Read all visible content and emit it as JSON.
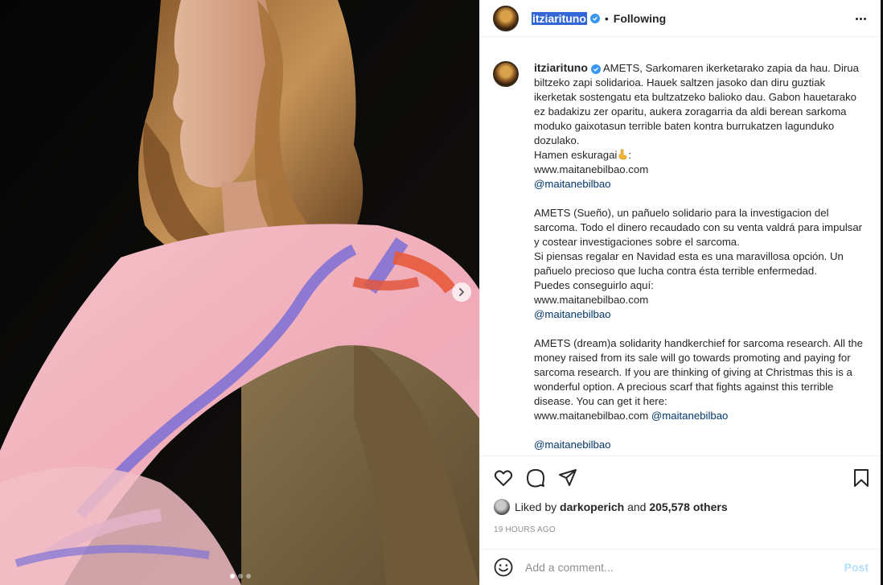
{
  "post": {
    "username": "itziarituno",
    "verified_icon": "verified-badge-icon",
    "follow_separator": "•",
    "follow_status": "Following",
    "more_icon": "more-options-icon"
  },
  "caption": {
    "username": "itziarituno",
    "paragraphs": [
      "AMETS, Sarkomaren ikerketarako zapia da hau. Dirua biltzeko zapi solidarioa. Hauek saltzen jasoko dan diru guztiak ikerketak sostengatu eta bultzatzeko balioko dau. Gabon hauetarako ez badakizu zer oparitu, aukera zoragarria da aldi berean sarkoma moduko gaixotasun terrible baten kontra burrukatzen lagunduko dozulako.",
      "Hamen eskuragai",
      ":",
      "www.maitanebilbao.com",
      "@maitanebilbao",
      "AMETS (Sueño), un pañuelo solidario para la investigacion del sarcoma. Todo el dinero recaudado con su venta valdrá para impulsar y costear investigaciones sobre el sarcoma.",
      "Si piensas regalar en Navidad esta es una maravillosa opción. Un pañuelo precioso que lucha contra ésta terrible enfermedad.",
      "Puedes conseguirlo aquí:",
      "www.maitanebilbao.com",
      "@maitanebilbao",
      "AMETS (dream)a solidarity handkerchief for sarcoma research. All the money raised from its sale will go towards promoting and paying for sarcoma research. If you are thinking of giving at Christmas this is a wonderful option. A precious scarf that fights against this terrible disease. You can get it here:",
      "www.maitanebilbao.com",
      "@maitanebilbao",
      "@maitanebilbao"
    ],
    "emoji": "pointing-down-hand-icon"
  },
  "actions": {
    "like_icon": "heart-icon",
    "comment_icon": "comment-icon",
    "share_icon": "paper-plane-icon",
    "save_icon": "bookmark-icon"
  },
  "likes": {
    "prefix": "Liked by",
    "user": "darkoperich",
    "connector": "and",
    "count": "205,578 others"
  },
  "timestamp": "19 HOURS AGO",
  "comment_box": {
    "placeholder": "Add a comment...",
    "post_label": "Post",
    "emoji_icon": "smiley-icon"
  },
  "carousel": {
    "slide_count": 3,
    "active_slide": 1,
    "next_icon": "chevron-right-icon"
  },
  "colors": {
    "link": "#00376b",
    "verified": "#3897f0",
    "post_button_disabled": "#b2dffc",
    "muted": "#8e8e8e"
  }
}
